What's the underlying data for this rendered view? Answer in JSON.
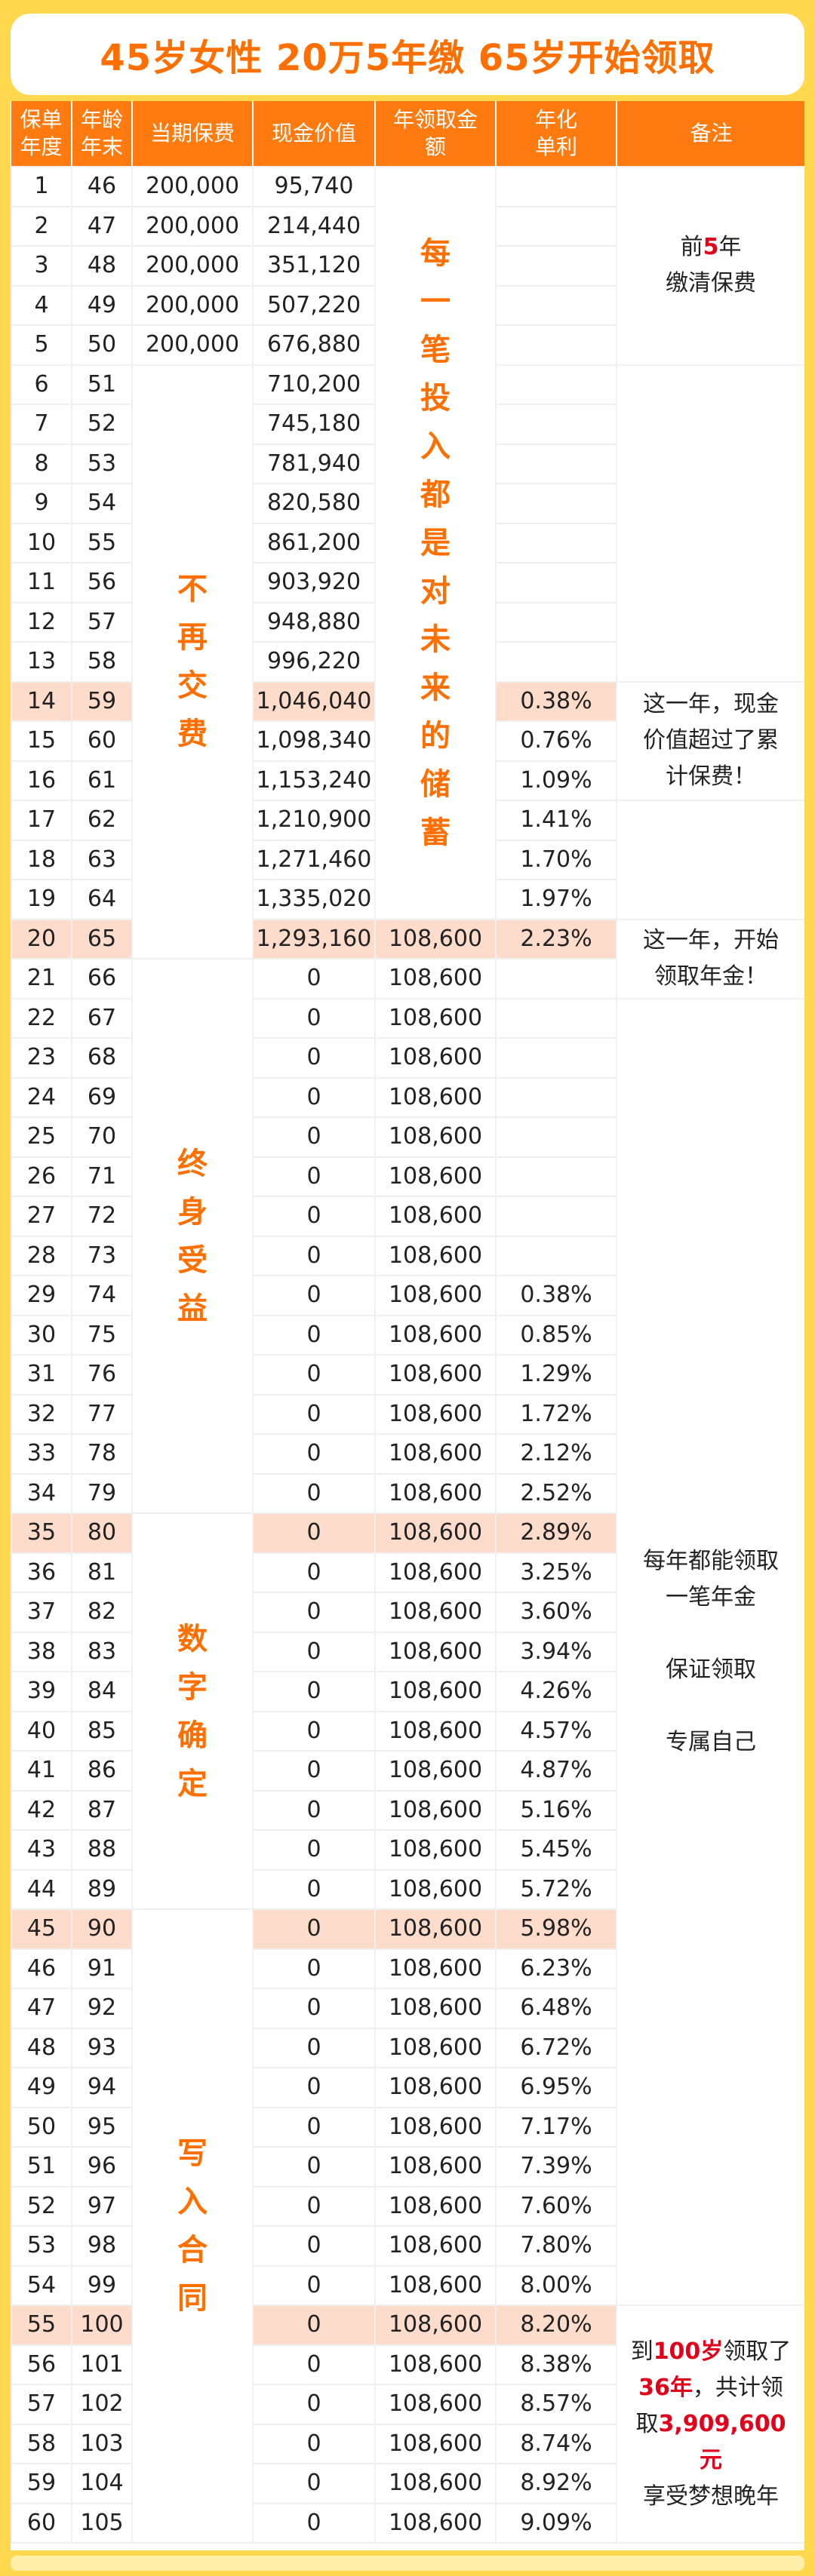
{
  "title": "45岁女性  20万5年缴  65岁开始领取",
  "headers": [
    "保单\n年度",
    "年龄\n年末",
    "当期保费",
    "现金价值",
    "年领取金\n额",
    "年化\n单利",
    "备注"
  ],
  "rows": [
    [
      "1",
      "46",
      "200,000",
      "95,740",
      "",
      ""
    ],
    [
      "2",
      "47",
      "200,000",
      "214,440",
      "",
      ""
    ],
    [
      "3",
      "48",
      "200,000",
      "351,120",
      "",
      ""
    ],
    [
      "4",
      "49",
      "200,000",
      "507,220",
      "",
      ""
    ],
    [
      "5",
      "50",
      "200,000",
      "676,880",
      "",
      ""
    ],
    [
      "6",
      "51",
      "",
      "710,200",
      "",
      ""
    ],
    [
      "7",
      "52",
      "",
      "745,180",
      "",
      ""
    ],
    [
      "8",
      "53",
      "",
      "781,940",
      "",
      ""
    ],
    [
      "9",
      "54",
      "",
      "820,580",
      "",
      ""
    ],
    [
      "10",
      "55",
      "",
      "861,200",
      "",
      ""
    ],
    [
      "11",
      "56",
      "",
      "903,920",
      "",
      ""
    ],
    [
      "12",
      "57",
      "",
      "948,880",
      "",
      ""
    ],
    [
      "13",
      "58",
      "",
      "996,220",
      "",
      ""
    ],
    [
      "14",
      "59",
      "",
      "1,046,040",
      "",
      "0.38%"
    ],
    [
      "15",
      "60",
      "",
      "1,098,340",
      "",
      "0.76%"
    ],
    [
      "16",
      "61",
      "",
      "1,153,240",
      "",
      "1.09%"
    ],
    [
      "17",
      "62",
      "",
      "1,210,900",
      "",
      "1.41%"
    ],
    [
      "18",
      "63",
      "",
      "1,271,460",
      "",
      "1.70%"
    ],
    [
      "19",
      "64",
      "",
      "1,335,020",
      "",
      "1.97%"
    ],
    [
      "20",
      "65",
      "",
      "1,293,160",
      "108,600",
      "2.23%"
    ],
    [
      "21",
      "66",
      "",
      "0",
      "108,600",
      ""
    ],
    [
      "22",
      "67",
      "",
      "0",
      "108,600",
      ""
    ],
    [
      "23",
      "68",
      "",
      "0",
      "108,600",
      ""
    ],
    [
      "24",
      "69",
      "",
      "0",
      "108,600",
      ""
    ],
    [
      "25",
      "70",
      "",
      "0",
      "108,600",
      ""
    ],
    [
      "26",
      "71",
      "",
      "0",
      "108,600",
      ""
    ],
    [
      "27",
      "72",
      "",
      "0",
      "108,600",
      ""
    ],
    [
      "28",
      "73",
      "",
      "0",
      "108,600",
      ""
    ],
    [
      "29",
      "74",
      "",
      "0",
      "108,600",
      "0.38%"
    ],
    [
      "30",
      "75",
      "",
      "0",
      "108,600",
      "0.85%"
    ],
    [
      "31",
      "76",
      "",
      "0",
      "108,600",
      "1.29%"
    ],
    [
      "32",
      "77",
      "",
      "0",
      "108,600",
      "1.72%"
    ],
    [
      "33",
      "78",
      "",
      "0",
      "108,600",
      "2.12%"
    ],
    [
      "34",
      "79",
      "",
      "0",
      "108,600",
      "2.52%"
    ],
    [
      "35",
      "80",
      "",
      "0",
      "108,600",
      "2.89%"
    ],
    [
      "36",
      "81",
      "",
      "0",
      "108,600",
      "3.25%"
    ],
    [
      "37",
      "82",
      "",
      "0",
      "108,600",
      "3.60%"
    ],
    [
      "38",
      "83",
      "",
      "0",
      "108,600",
      "3.94%"
    ],
    [
      "39",
      "84",
      "",
      "0",
      "108,600",
      "4.26%"
    ],
    [
      "40",
      "85",
      "",
      "0",
      "108,600",
      "4.57%"
    ],
    [
      "41",
      "86",
      "",
      "0",
      "108,600",
      "4.87%"
    ],
    [
      "42",
      "87",
      "",
      "0",
      "108,600",
      "5.16%"
    ],
    [
      "43",
      "88",
      "",
      "0",
      "108,600",
      "5.45%"
    ],
    [
      "44",
      "89",
      "",
      "0",
      "108,600",
      "5.72%"
    ],
    [
      "45",
      "90",
      "",
      "0",
      "108,600",
      "5.98%"
    ],
    [
      "46",
      "91",
      "",
      "0",
      "108,600",
      "6.23%"
    ],
    [
      "47",
      "92",
      "",
      "0",
      "108,600",
      "6.48%"
    ],
    [
      "48",
      "93",
      "",
      "0",
      "108,600",
      "6.72%"
    ],
    [
      "49",
      "94",
      "",
      "0",
      "108,600",
      "6.95%"
    ],
    [
      "50",
      "95",
      "",
      "0",
      "108,600",
      "7.17%"
    ],
    [
      "51",
      "96",
      "",
      "0",
      "108,600",
      "7.39%"
    ],
    [
      "52",
      "97",
      "",
      "0",
      "108,600",
      "7.60%"
    ],
    [
      "53",
      "98",
      "",
      "0",
      "108,600",
      "7.80%"
    ],
    [
      "54",
      "99",
      "",
      "0",
      "108,600",
      "8.00%"
    ],
    [
      "55",
      "100",
      "",
      "0",
      "108,600",
      "8.20%"
    ],
    [
      "56",
      "101",
      "",
      "0",
      "108,600",
      "8.38%"
    ],
    [
      "57",
      "102",
      "",
      "0",
      "108,600",
      "8.57%"
    ],
    [
      "58",
      "103",
      "",
      "0",
      "108,600",
      "8.74%"
    ],
    [
      "59",
      "104",
      "",
      "0",
      "108,600",
      "8.92%"
    ],
    [
      "60",
      "105",
      "",
      "0",
      "108,600",
      "9.09%"
    ]
  ],
  "highlight_years": [
    14,
    20,
    35,
    45,
    55
  ],
  "premium_groups": [
    {
      "start": 6,
      "end": 20,
      "text": "不\n再\n交\n费"
    },
    {
      "start": 21,
      "end": 34,
      "text": "终\n身\n受\n益"
    },
    {
      "start": 35,
      "end": 44,
      "text": "数\n字\n确\n定"
    },
    {
      "start": 45,
      "end": 60,
      "text": "写\n入\n合\n同"
    }
  ],
  "payout_group": {
    "start": 1,
    "end": 19,
    "text": "每\n一\n笔\n投\n入\n都\n是\n对\n未\n来\n的\n储\n蓄"
  },
  "notes": [
    {
      "start": 1,
      "end": 5,
      "html": "前<span class='red'>5</span>年<br>缴清保费"
    },
    {
      "start": 6,
      "end": 13,
      "html": ""
    },
    {
      "start": 14,
      "end": 16,
      "html": "这一年，现金<br>价值超过了累<br>计保费！"
    },
    {
      "start": 17,
      "end": 19,
      "html": ""
    },
    {
      "start": 20,
      "end": 21,
      "html": "这一年，开始<br>领取年金！"
    },
    {
      "start": 22,
      "end": 54,
      "html": "每年都能领取<br>一笔年金<br><br>保证领取<br><br>专属自己"
    },
    {
      "start": 55,
      "end": 60,
      "html": "到<span class='red'>100岁</span>领取了<br><span class='red'>36年</span>，共计领<br>取<span class='red'>3,909,600<br>元</span><br>享受梦想晚年"
    }
  ],
  "colors": {
    "accent": "#FF7A0F",
    "title": "#FF6F00",
    "highlight": "#FDDCCB",
    "background": "#FFD84D",
    "red": "#E3001B"
  }
}
